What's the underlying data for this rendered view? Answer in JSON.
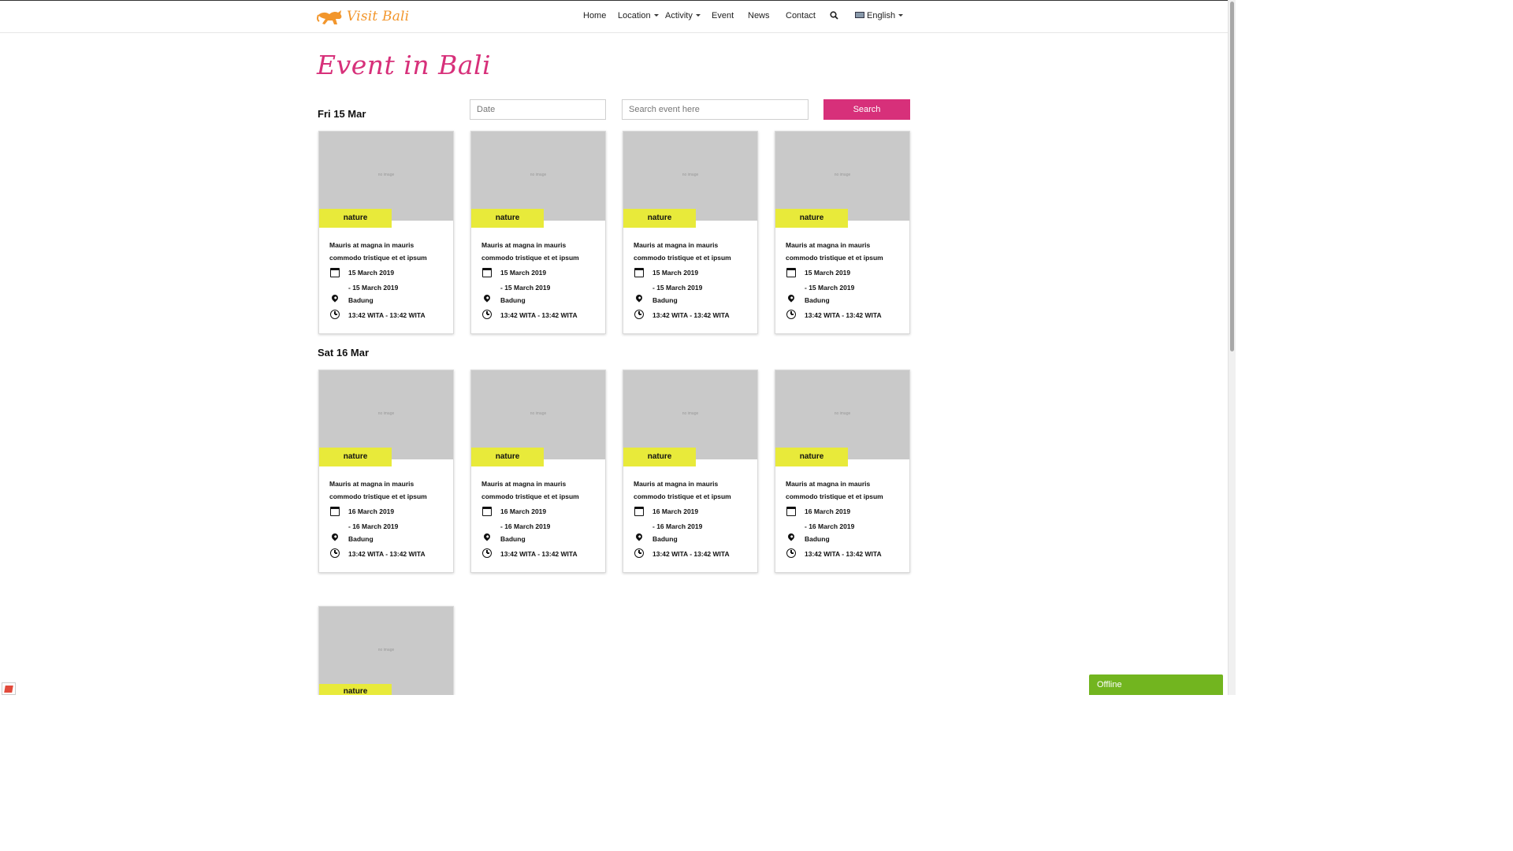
{
  "nav": {
    "logo_text": "Visit Bali",
    "links": {
      "home": "Home",
      "location": "Location",
      "activity": "Activity",
      "event": "Event",
      "news": "News",
      "contact": "Contact",
      "language": "English"
    }
  },
  "page": {
    "title": "Event in Bali"
  },
  "search": {
    "date_placeholder": "Date",
    "query_placeholder": "Search event here",
    "button_label": "Search"
  },
  "days": [
    {
      "heading": "Fri 15 Mar",
      "cards": [
        {
          "image_text": "no image",
          "tag": "nature",
          "title": "Mauris at magna in mauris commodo tristique et et ipsum",
          "date_start": "15 March 2019",
          "date_end": "- 15 March 2019",
          "location": "Badung",
          "time": "13:42 WITA - 13:42 WITA"
        },
        {
          "image_text": "no image",
          "tag": "nature",
          "title": "Mauris at magna in mauris commodo tristique et et ipsum",
          "date_start": "15 March 2019",
          "date_end": "- 15 March 2019",
          "location": "Badung",
          "time": "13:42 WITA - 13:42 WITA"
        },
        {
          "image_text": "no image",
          "tag": "nature",
          "title": "Mauris at magna in mauris commodo tristique et et ipsum",
          "date_start": "15 March 2019",
          "date_end": "- 15 March 2019",
          "location": "Badung",
          "time": "13:42 WITA - 13:42 WITA"
        },
        {
          "image_text": "no image",
          "tag": "nature",
          "title": "Mauris at magna in mauris commodo tristique et et ipsum",
          "date_start": "15 March 2019",
          "date_end": "- 15 March 2019",
          "location": "Badung",
          "time": "13:42 WITA - 13:42 WITA"
        }
      ]
    },
    {
      "heading": "Sat 16 Mar",
      "cards": [
        {
          "image_text": "no image",
          "tag": "nature",
          "title": "Mauris at magna in mauris commodo tristique et et ipsum",
          "date_start": "16 March 2019",
          "date_end": "- 16 March 2019",
          "location": "Badung",
          "time": "13:42 WITA - 13:42 WITA"
        },
        {
          "image_text": "no image",
          "tag": "nature",
          "title": "Mauris at magna in mauris commodo tristique et et ipsum",
          "date_start": "16 March 2019",
          "date_end": "- 16 March 2019",
          "location": "Badung",
          "time": "13:42 WITA - 13:42 WITA"
        },
        {
          "image_text": "no image",
          "tag": "nature",
          "title": "Mauris at magna in mauris commodo tristique et et ipsum",
          "date_start": "16 March 2019",
          "date_end": "- 16 March 2019",
          "location": "Badung",
          "time": "13:42 WITA - 13:42 WITA"
        },
        {
          "image_text": "no image",
          "tag": "nature",
          "title": "Mauris at magna in mauris commodo tristique et et ipsum",
          "date_start": "16 March 2019",
          "date_end": "- 16 March 2019",
          "location": "Badung",
          "time": "13:42 WITA - 13:42 WITA"
        }
      ]
    },
    {
      "heading": "",
      "cards": [
        {
          "image_text": "no image",
          "tag": "nature"
        }
      ]
    }
  ],
  "chat": {
    "status": "Offline"
  },
  "colors": {
    "brand_pink": "#d7307a",
    "logo_orange": "#f2962c",
    "tag_yellow": "#e8ea3a",
    "offline_green": "#72b51f"
  },
  "icons": [
    "kangaroo-logo-icon",
    "search-icon",
    "flag-icon",
    "calendar-icon",
    "map-pin-icon",
    "clock-icon"
  ]
}
